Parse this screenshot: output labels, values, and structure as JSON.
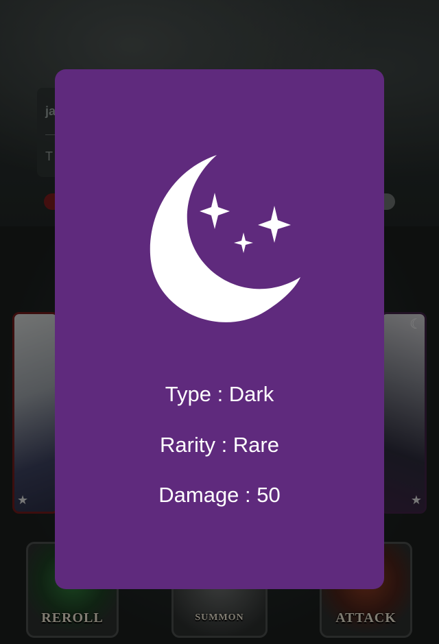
{
  "background": {
    "panel_text_1": "ja",
    "panel_text_2": "T",
    "buttons": {
      "reroll": "REROLL",
      "summon": "SUMMON",
      "attack": "ATTACK"
    }
  },
  "card_modal": {
    "icon": "moon-stars-icon",
    "type_label": "Type : Dark",
    "rarity_label": "Rarity : Rare",
    "damage_label": "Damage : 50"
  },
  "colors": {
    "modal_bg": "#5f2a7d",
    "text": "#ffffff"
  }
}
